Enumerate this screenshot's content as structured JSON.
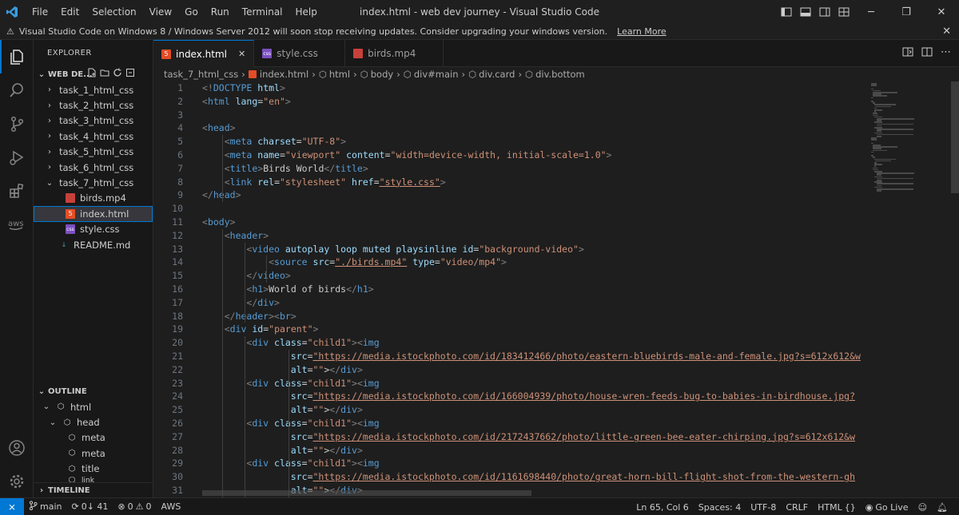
{
  "window": {
    "title": "index.html - web dev journey - Visual Studio Code",
    "menu": [
      "File",
      "Edit",
      "Selection",
      "View",
      "Go",
      "Run",
      "Terminal",
      "Help"
    ]
  },
  "banner": {
    "text": "Visual Studio Code on Windows 8 / Windows Server 2012 will soon stop receiving updates. Consider upgrading your windows version.",
    "link": "Learn More"
  },
  "sidebar": {
    "title": "EXPLORER",
    "workspace": "WEB DE...",
    "folders": [
      "task_1_html_css",
      "task_2_html_css",
      "task_3_html_css",
      "task_4_html_css",
      "task_5_html_css",
      "task_6_html_css",
      "task_7_html_css"
    ],
    "task7_files": [
      "birds.mp4",
      "index.html",
      "style.css"
    ],
    "root_files": [
      "README.md"
    ],
    "outline_title": "OUTLINE",
    "outline_items": [
      "html",
      "head",
      "meta",
      "meta",
      "title",
      "link"
    ],
    "timeline_title": "TIMELINE"
  },
  "tabs": [
    {
      "label": "index.html",
      "active": true
    },
    {
      "label": "style.css",
      "active": false
    },
    {
      "label": "birds.mp4",
      "active": false
    }
  ],
  "breadcrumb": [
    "task_7_html_css",
    "index.html",
    "html",
    "body",
    "div#main",
    "div.card",
    "div.bottom"
  ],
  "editor": {
    "lines": [
      "<!DOCTYPE html>",
      "<html lang=\"en\">",
      "",
      "<head>",
      "    <meta charset=\"UTF-8\">",
      "    <meta name=\"viewport\" content=\"width=device-width, initial-scale=1.0\">",
      "    <title>Birds World</title>",
      "    <link rel=\"stylesheet\" href=\"style.css\">",
      "</head>",
      "",
      "<body>",
      "    <header>",
      "        <video autoplay loop muted playsinline id=\"background-video\">",
      "            <source src=\"./birds.mp4\" type=\"video/mp4\">",
      "        </video>",
      "        <h1>World of birds</h1>",
      "        </div>",
      "    </header><br>",
      "    <div id=\"parent\">",
      "        <div class=\"child1\"><img",
      "                src=\"https://media.istockphoto.com/id/183412466/photo/eastern-bluebirds-male-and-female.jpg?s=612x612&w",
      "                alt=\"\"></div>",
      "        <div class=\"child1\"><img",
      "                src=\"https://media.istockphoto.com/id/166004939/photo/house-wren-feeds-bug-to-babies-in-birdhouse.jpg?",
      "                alt=\"\"></div>",
      "        <div class=\"child1\"><img",
      "                src=\"https://media.istockphoto.com/id/2172437662/photo/little-green-bee-eater-chirping.jpg?s=612x612&w",
      "                alt=\"\"></div>",
      "        <div class=\"child1\"><img",
      "                src=\"https://media.istockphoto.com/id/1161698440/photo/great-horn-bill-flight-shot-from-the-western-gh",
      "                alt=\"\"></div>"
    ]
  },
  "statusbar": {
    "branch": "main",
    "sync": "0↓ 41",
    "problems": "0 ⚠ 0",
    "errors": "0",
    "warnings": "0",
    "aws": "AWS",
    "position": "Ln 65, Col 6",
    "spaces": "Spaces: 4",
    "encoding": "UTF-8",
    "eol": "CRLF",
    "language": "HTML",
    "golive": "Go Live"
  },
  "colors": {
    "accent": "#0078d4",
    "html_icon": "#e44d26",
    "css_icon": "#7b4fbf",
    "tag": "#569cd6",
    "attr": "#9cdcfe",
    "string": "#ce9178"
  }
}
